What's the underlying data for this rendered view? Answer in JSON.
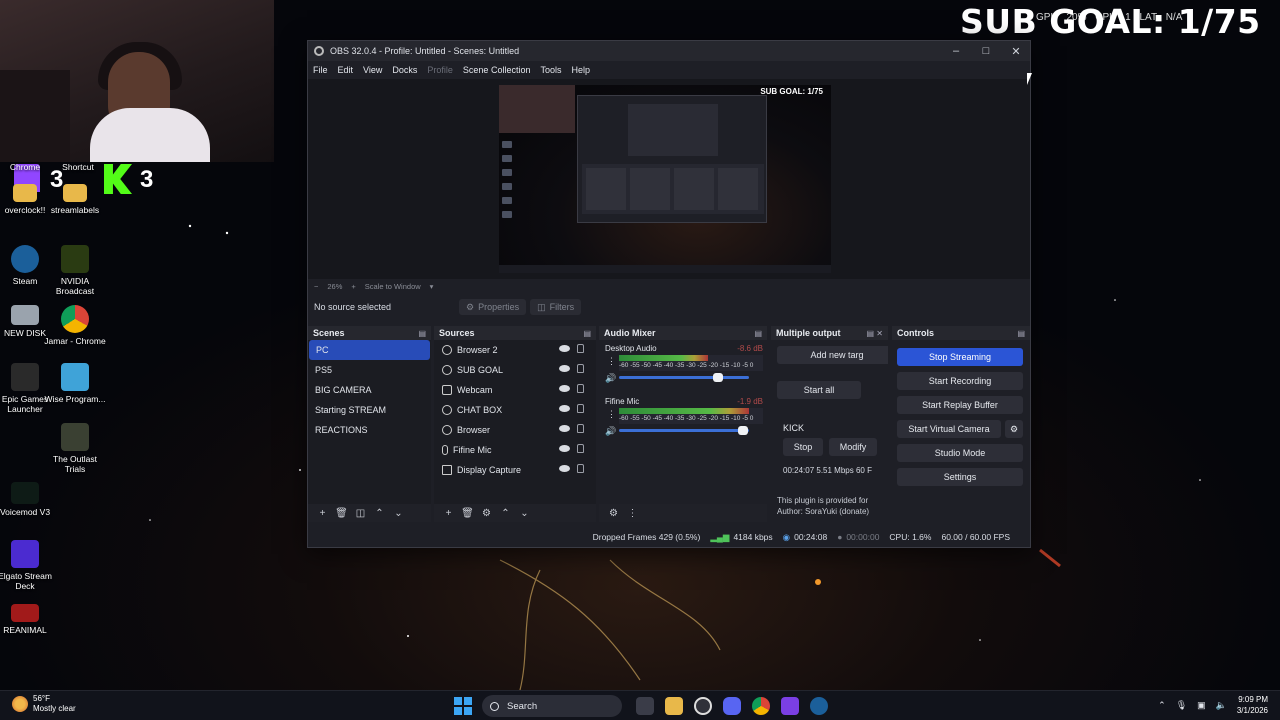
{
  "overlay": {
    "sub_goal": "SUB GOAL: 1/75",
    "stats_left": "GPU",
    "stats_gpu": "20%",
    "stats_cpu": "CPU",
    "stats_na1": "1",
    "stats_lat": "LAT",
    "stats_na": "N/A",
    "twitch_count": "3",
    "kick_count": "3"
  },
  "desktop": {
    "icons": [
      {
        "label": "Chrome"
      },
      {
        "label": "Shortcut"
      },
      {
        "label": "overclock!!"
      },
      {
        "label": "streamlabels"
      },
      {
        "label": "Steam"
      },
      {
        "label": "NVIDIA Broadcast"
      },
      {
        "label": "NEW DISK"
      },
      {
        "label": "Jamar - Chrome"
      },
      {
        "label": "Epic Games Launcher"
      },
      {
        "label": "Wise Program..."
      },
      {
        "label": "The Outlast Trials"
      },
      {
        "label": "Voicemod V3"
      },
      {
        "label": "Elgato Stream Deck"
      },
      {
        "label": "REANIMAL"
      }
    ]
  },
  "obs": {
    "title": "OBS 32.0.4 - Profile: Untitled - Scenes: Untitled",
    "menu": [
      "File",
      "Edit",
      "View",
      "Docks",
      "Profile",
      "Scene Collection",
      "Tools",
      "Help"
    ],
    "preview_title": "SUB GOAL: 1/75",
    "zoom": {
      "minus": "−",
      "value": "26%",
      "plus": "+",
      "mode": "Scale to Window"
    },
    "no_source": "No source selected",
    "properties": "Properties",
    "filters": "Filters",
    "scenes": {
      "title": "Scenes",
      "items": [
        "PC",
        "PS5",
        "BIG CAMERA",
        "Starting STREAM",
        "REACTIONS"
      ]
    },
    "sources": {
      "title": "Sources",
      "items": [
        "Browser 2",
        "SUB GOAL",
        "Webcam",
        "CHAT BOX",
        "Browser",
        "Fifine Mic",
        "Display Capture"
      ]
    },
    "mixer": {
      "title": "Audio Mixer",
      "channels": [
        {
          "name": "Desktop Audio",
          "db": "-8.6 dB",
          "level": 0.62,
          "volume": 0.76
        },
        {
          "name": "Fifine Mic",
          "db": "-1.9 dB",
          "level": 0.9,
          "volume": 0.95
        }
      ],
      "scale": "-60 -55 -50 -45 -40 -35 -30 -25 -20 -15 -10 -5 0"
    },
    "multi_output": {
      "title": "Multiple output",
      "add": "Add new targ",
      "start_all": "Start all",
      "target": "KICK",
      "stop": "Stop",
      "modify": "Modify",
      "stats": "00:24:07  5.51 Mbps  60 F",
      "plugin_note": "This plugin is provided for",
      "author": "Author: SoraYuki (donate)"
    },
    "controls": {
      "title": "Controls",
      "stop_streaming": "Stop Streaming",
      "start_recording": "Start Recording",
      "start_replay": "Start Replay Buffer",
      "start_vcam": "Start Virtual Camera",
      "studio_mode": "Studio Mode",
      "settings": "Settings"
    },
    "status": {
      "dropped": "Dropped Frames 429 (0.5%)",
      "bitrate": "4184 kbps",
      "stream_time": "00:24:08",
      "rec_time": "00:00:00",
      "cpu": "CPU: 1.6%",
      "fps": "60.00 / 60.00 FPS"
    }
  },
  "taskbar": {
    "weather_temp": "56°F",
    "weather_desc": "Mostly clear",
    "search": "Search",
    "time": "9:09 PM",
    "date": "3/1/2026"
  },
  "colors": {
    "accent": "#2b55d6",
    "kick": "#53fc18",
    "twitch": "#9146ff"
  }
}
